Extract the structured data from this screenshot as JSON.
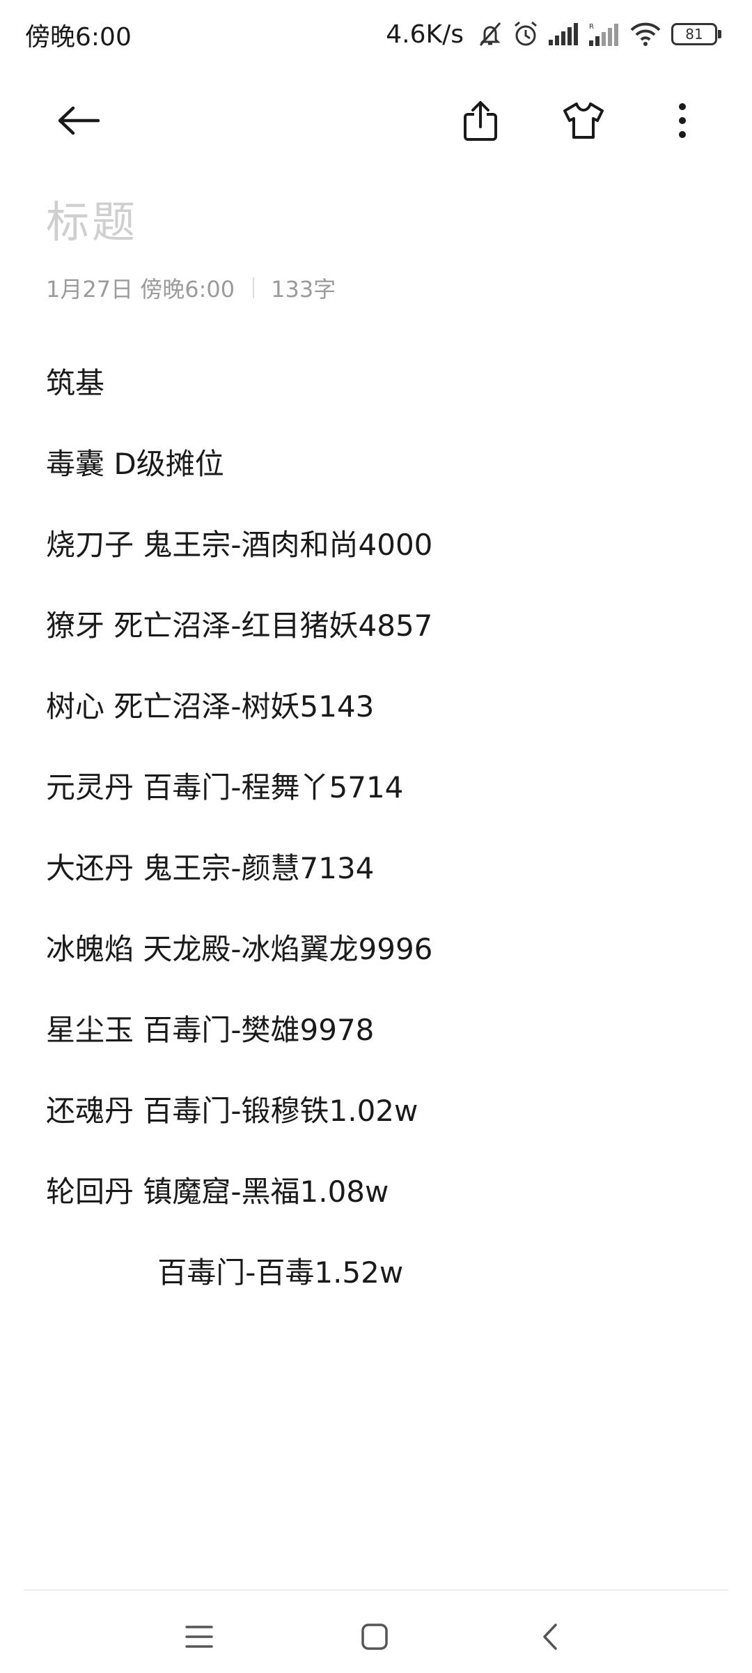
{
  "status_bar": {
    "time": "傍晚6:00",
    "net_speed": "4.6K/s",
    "battery_level": "81",
    "icons": [
      "bell-muted-icon",
      "alarm-icon",
      "signal-icon",
      "signal-roaming-icon",
      "wifi-icon",
      "battery-icon"
    ]
  },
  "toolbar": {
    "icons": [
      "back-arrow-icon",
      "share-icon",
      "tshirt-icon",
      "more-vertical-icon"
    ]
  },
  "note": {
    "title_placeholder": "标题",
    "date": "1月27日 傍晚6:00",
    "word_count": "133字",
    "lines": [
      "筑基",
      "毒囊 D级摊位",
      "烧刀子 鬼王宗-酒肉和尚4000",
      "獠牙 死亡沼泽-红目猪妖4857",
      "树心 死亡沼泽-树妖5143",
      "元灵丹 百毒门-程舞丫5714",
      "大还丹 鬼王宗-颜慧7134",
      "冰魄焰 天龙殿-冰焰翼龙9996",
      "星尘玉 百毒门-樊雄9978",
      "还魂丹 百毒门-锻穆铁1.02w",
      "轮回丹 镇魔窟-黑福1.08w",
      "            百毒门-百毒1.52w"
    ]
  },
  "nav_bar": {
    "icons": [
      "menu-icon",
      "home-icon",
      "back-icon"
    ]
  }
}
